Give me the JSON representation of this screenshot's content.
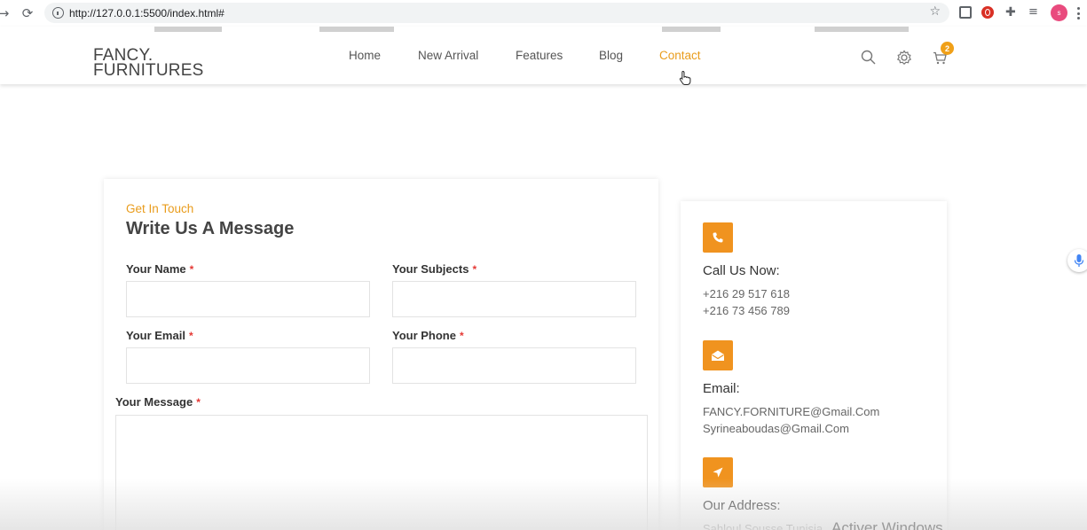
{
  "browser": {
    "url": "http://127.0.0.1:5500/index.html#",
    "profile_initial": "s"
  },
  "header": {
    "brand_line1": "FANCY.",
    "brand_line2": "FURNITURES",
    "menu": [
      {
        "label": "Home",
        "active": false
      },
      {
        "label": "New Arrival",
        "active": false
      },
      {
        "label": "Features",
        "active": false
      },
      {
        "label": "Blog",
        "active": false
      },
      {
        "label": "Contact",
        "active": true
      }
    ],
    "cart_count": "2",
    "accent_color": "#e99c1c"
  },
  "form": {
    "eyebrow": "Get In Touch",
    "title": "Write Us A Message",
    "fields": {
      "name_label": "Your Name",
      "subjects_label": "Your Subjects",
      "email_label": "Your Email",
      "phone_label": "Your Phone",
      "message_label": "Your Message",
      "required_mark": "*"
    }
  },
  "contact_info": {
    "call": {
      "title": "Call Us Now:",
      "lines": [
        "+216 29 517 618",
        "+216 73 456 789"
      ]
    },
    "email": {
      "title": "Email:",
      "lines": [
        "FANCY.FORNITURE@Gmail.Com",
        "Syrineaboudas@Gmail.Com"
      ]
    },
    "address": {
      "title": "Our Address:",
      "lines": [
        "Sahloul Sousse Tunisia"
      ]
    }
  },
  "watermark": "Activer Windows"
}
